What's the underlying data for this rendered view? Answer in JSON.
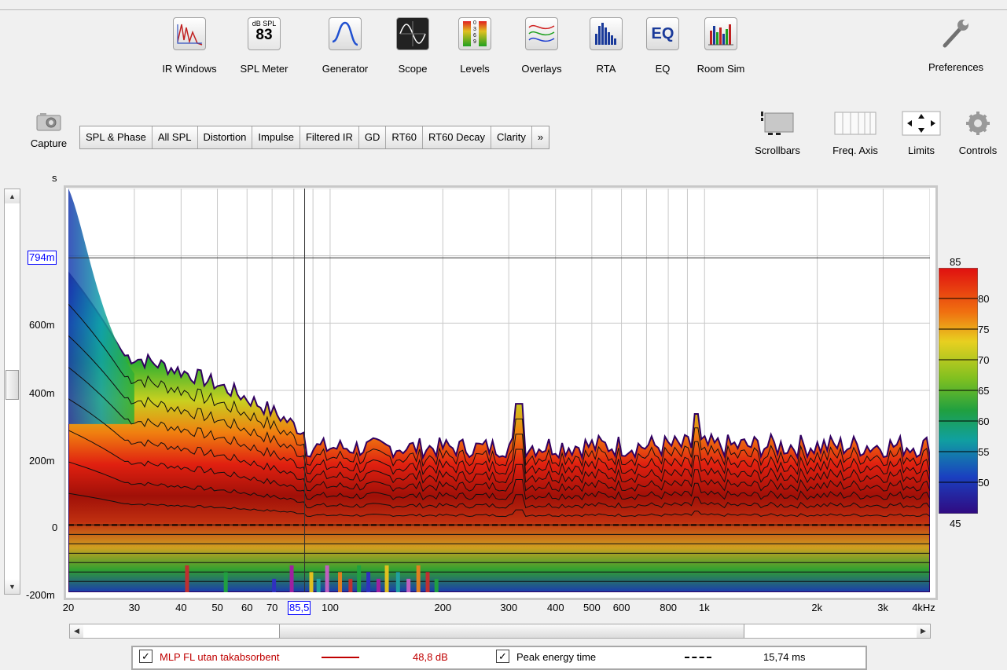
{
  "toolbar": {
    "items": [
      {
        "id": "ir-windows",
        "label": "IR Windows"
      },
      {
        "id": "spl-meter",
        "label": "SPL Meter",
        "icon_top": "dB SPL",
        "icon_value": "83"
      },
      {
        "id": "generator",
        "label": "Generator"
      },
      {
        "id": "scope",
        "label": "Scope"
      },
      {
        "id": "levels",
        "label": "Levels",
        "icon_text": "0 3 6 9"
      },
      {
        "id": "overlays",
        "label": "Overlays"
      },
      {
        "id": "rta",
        "label": "RTA"
      },
      {
        "id": "eq",
        "label": "EQ",
        "icon_text": "EQ"
      },
      {
        "id": "room-sim",
        "label": "Room Sim"
      }
    ],
    "preferences_label": "Preferences"
  },
  "capture_label": "Capture",
  "tabs": [
    "SPL & Phase",
    "All SPL",
    "Distortion",
    "Impulse",
    "Filtered IR",
    "GD",
    "RT60",
    "RT60 Decay",
    "Clarity",
    "»"
  ],
  "right_tools": {
    "scrollbars": "Scrollbars",
    "freq_axis": "Freq. Axis",
    "limits": "Limits",
    "controls": "Controls"
  },
  "chart_data": {
    "type": "heatmap",
    "description_kind": "spectrogram",
    "ylabel": "s",
    "y_ticks": [
      "600m",
      "400m",
      "200m",
      "0",
      "-200m"
    ],
    "y_tick_values": [
      0.6,
      0.4,
      0.2,
      0,
      -0.2
    ],
    "ylim": [
      -0.2,
      1.0
    ],
    "x_ticks": [
      "20",
      "30",
      "40",
      "50",
      "60",
      "70",
      "100",
      "200",
      "300",
      "400",
      "500",
      "600",
      "800",
      "1k",
      "2k",
      "3k",
      "4kHz"
    ],
    "x_tick_values": [
      20,
      30,
      40,
      50,
      60,
      70,
      100,
      200,
      300,
      400,
      500,
      600,
      800,
      1000,
      2000,
      3000,
      4000
    ],
    "xlim": [
      20,
      4000
    ],
    "x_scale": "log",
    "cursor": {
      "x_label": "85,5",
      "x_value": 85.5,
      "y_label": "794m",
      "y_value": 0.794
    },
    "colorbar": {
      "min_label": "45",
      "max_label": "85",
      "ticks": [
        "80",
        "75",
        "70",
        "65",
        "60",
        "55",
        "50"
      ],
      "min": 45,
      "max": 85
    },
    "contour_dB": [
      50,
      55,
      60,
      65,
      70,
      75,
      80,
      85
    ],
    "peak_energy_line_s": 0.0
  },
  "legend": {
    "series": {
      "name": "MLP FL utan takabsorbent",
      "value": "48,8 dB",
      "color": "#c00000",
      "checked": "✓"
    },
    "peak": {
      "name": "Peak energy time",
      "value": "15,74 ms",
      "checked": "✓"
    }
  },
  "scroll_arrows": {
    "up": "▲",
    "down": "▼",
    "left": "◀",
    "right": "▶"
  }
}
